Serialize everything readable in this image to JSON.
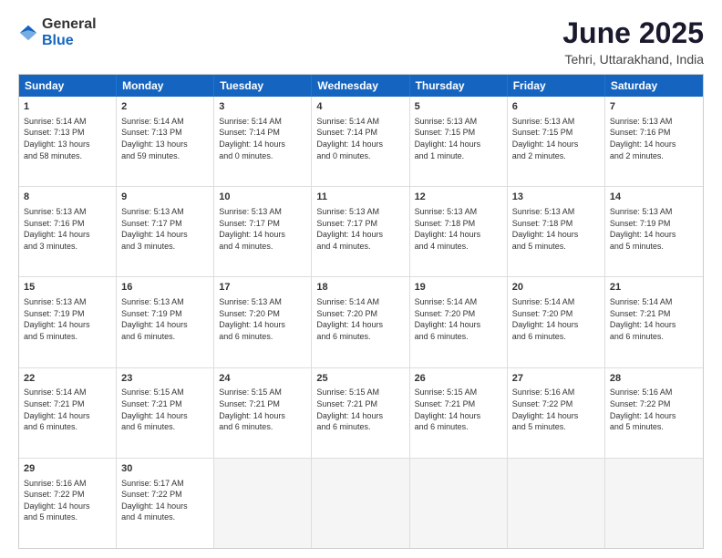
{
  "logo": {
    "general": "General",
    "blue": "Blue"
  },
  "header": {
    "month": "June 2025",
    "location": "Tehri, Uttarakhand, India"
  },
  "weekdays": [
    "Sunday",
    "Monday",
    "Tuesday",
    "Wednesday",
    "Thursday",
    "Friday",
    "Saturday"
  ],
  "rows": [
    [
      {
        "day": "1",
        "info": "Sunrise: 5:14 AM\nSunset: 7:13 PM\nDaylight: 13 hours\nand 58 minutes."
      },
      {
        "day": "2",
        "info": "Sunrise: 5:14 AM\nSunset: 7:13 PM\nDaylight: 13 hours\nand 59 minutes."
      },
      {
        "day": "3",
        "info": "Sunrise: 5:14 AM\nSunset: 7:14 PM\nDaylight: 14 hours\nand 0 minutes."
      },
      {
        "day": "4",
        "info": "Sunrise: 5:14 AM\nSunset: 7:14 PM\nDaylight: 14 hours\nand 0 minutes."
      },
      {
        "day": "5",
        "info": "Sunrise: 5:13 AM\nSunset: 7:15 PM\nDaylight: 14 hours\nand 1 minute."
      },
      {
        "day": "6",
        "info": "Sunrise: 5:13 AM\nSunset: 7:15 PM\nDaylight: 14 hours\nand 2 minutes."
      },
      {
        "day": "7",
        "info": "Sunrise: 5:13 AM\nSunset: 7:16 PM\nDaylight: 14 hours\nand 2 minutes."
      }
    ],
    [
      {
        "day": "8",
        "info": "Sunrise: 5:13 AM\nSunset: 7:16 PM\nDaylight: 14 hours\nand 3 minutes."
      },
      {
        "day": "9",
        "info": "Sunrise: 5:13 AM\nSunset: 7:17 PM\nDaylight: 14 hours\nand 3 minutes."
      },
      {
        "day": "10",
        "info": "Sunrise: 5:13 AM\nSunset: 7:17 PM\nDaylight: 14 hours\nand 4 minutes."
      },
      {
        "day": "11",
        "info": "Sunrise: 5:13 AM\nSunset: 7:17 PM\nDaylight: 14 hours\nand 4 minutes."
      },
      {
        "day": "12",
        "info": "Sunrise: 5:13 AM\nSunset: 7:18 PM\nDaylight: 14 hours\nand 4 minutes."
      },
      {
        "day": "13",
        "info": "Sunrise: 5:13 AM\nSunset: 7:18 PM\nDaylight: 14 hours\nand 5 minutes."
      },
      {
        "day": "14",
        "info": "Sunrise: 5:13 AM\nSunset: 7:19 PM\nDaylight: 14 hours\nand 5 minutes."
      }
    ],
    [
      {
        "day": "15",
        "info": "Sunrise: 5:13 AM\nSunset: 7:19 PM\nDaylight: 14 hours\nand 5 minutes."
      },
      {
        "day": "16",
        "info": "Sunrise: 5:13 AM\nSunset: 7:19 PM\nDaylight: 14 hours\nand 6 minutes."
      },
      {
        "day": "17",
        "info": "Sunrise: 5:13 AM\nSunset: 7:20 PM\nDaylight: 14 hours\nand 6 minutes."
      },
      {
        "day": "18",
        "info": "Sunrise: 5:14 AM\nSunset: 7:20 PM\nDaylight: 14 hours\nand 6 minutes."
      },
      {
        "day": "19",
        "info": "Sunrise: 5:14 AM\nSunset: 7:20 PM\nDaylight: 14 hours\nand 6 minutes."
      },
      {
        "day": "20",
        "info": "Sunrise: 5:14 AM\nSunset: 7:20 PM\nDaylight: 14 hours\nand 6 minutes."
      },
      {
        "day": "21",
        "info": "Sunrise: 5:14 AM\nSunset: 7:21 PM\nDaylight: 14 hours\nand 6 minutes."
      }
    ],
    [
      {
        "day": "22",
        "info": "Sunrise: 5:14 AM\nSunset: 7:21 PM\nDaylight: 14 hours\nand 6 minutes."
      },
      {
        "day": "23",
        "info": "Sunrise: 5:15 AM\nSunset: 7:21 PM\nDaylight: 14 hours\nand 6 minutes."
      },
      {
        "day": "24",
        "info": "Sunrise: 5:15 AM\nSunset: 7:21 PM\nDaylight: 14 hours\nand 6 minutes."
      },
      {
        "day": "25",
        "info": "Sunrise: 5:15 AM\nSunset: 7:21 PM\nDaylight: 14 hours\nand 6 minutes."
      },
      {
        "day": "26",
        "info": "Sunrise: 5:15 AM\nSunset: 7:21 PM\nDaylight: 14 hours\nand 6 minutes."
      },
      {
        "day": "27",
        "info": "Sunrise: 5:16 AM\nSunset: 7:22 PM\nDaylight: 14 hours\nand 5 minutes."
      },
      {
        "day": "28",
        "info": "Sunrise: 5:16 AM\nSunset: 7:22 PM\nDaylight: 14 hours\nand 5 minutes."
      }
    ],
    [
      {
        "day": "29",
        "info": "Sunrise: 5:16 AM\nSunset: 7:22 PM\nDaylight: 14 hours\nand 5 minutes."
      },
      {
        "day": "30",
        "info": "Sunrise: 5:17 AM\nSunset: 7:22 PM\nDaylight: 14 hours\nand 4 minutes."
      },
      {
        "day": "",
        "info": ""
      },
      {
        "day": "",
        "info": ""
      },
      {
        "day": "",
        "info": ""
      },
      {
        "day": "",
        "info": ""
      },
      {
        "day": "",
        "info": ""
      }
    ]
  ]
}
